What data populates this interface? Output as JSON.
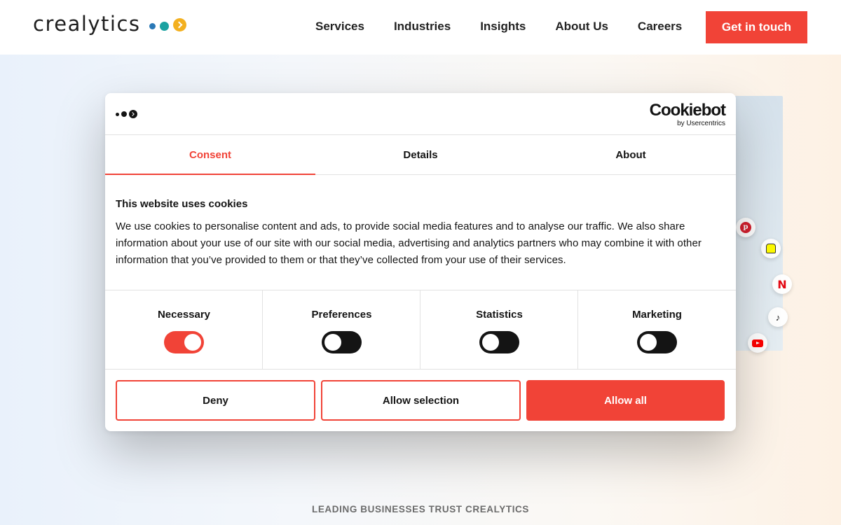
{
  "header": {
    "logo_text": "crealytics",
    "nav": [
      "Services",
      "Industries",
      "Insights",
      "About Us",
      "Careers"
    ],
    "cta_label": "Get in touch"
  },
  "hero": {
    "trust_text": "LEADING BUSINESSES TRUST CREALYTICS",
    "social_icons": [
      "pinterest-icon",
      "snapchat-icon",
      "netflix-icon",
      "tiktok-icon",
      "youtube-icon"
    ],
    "netflix_glyph": "N",
    "pinterest_glyph": "p",
    "tiktok_glyph": "♪"
  },
  "cookie_dialog": {
    "brand_name": "Cookiebot",
    "brand_by": "by Usercentrics",
    "tabs": [
      {
        "label": "Consent",
        "active": true
      },
      {
        "label": "Details",
        "active": false
      },
      {
        "label": "About",
        "active": false
      }
    ],
    "title": "This website uses cookies",
    "body": "We use cookies to personalise content and ads, to provide social media features and to analyse our traffic. We also share information about your use of our site with our social media, advertising and analytics partners who may combine it with other information that you’ve provided to them or that they’ve collected from your use of their services.",
    "toggles": [
      {
        "label": "Necessary",
        "on": true
      },
      {
        "label": "Preferences",
        "on": false
      },
      {
        "label": "Statistics",
        "on": false
      },
      {
        "label": "Marketing",
        "on": false
      }
    ],
    "buttons": {
      "deny": "Deny",
      "allow_selection": "Allow selection",
      "allow_all": "Allow all"
    }
  },
  "colors": {
    "accent": "#f14337",
    "dark": "#141414",
    "logo_blue": "#2a78b6",
    "logo_teal": "#1ba2a1",
    "logo_yellow": "#f3b01f"
  }
}
